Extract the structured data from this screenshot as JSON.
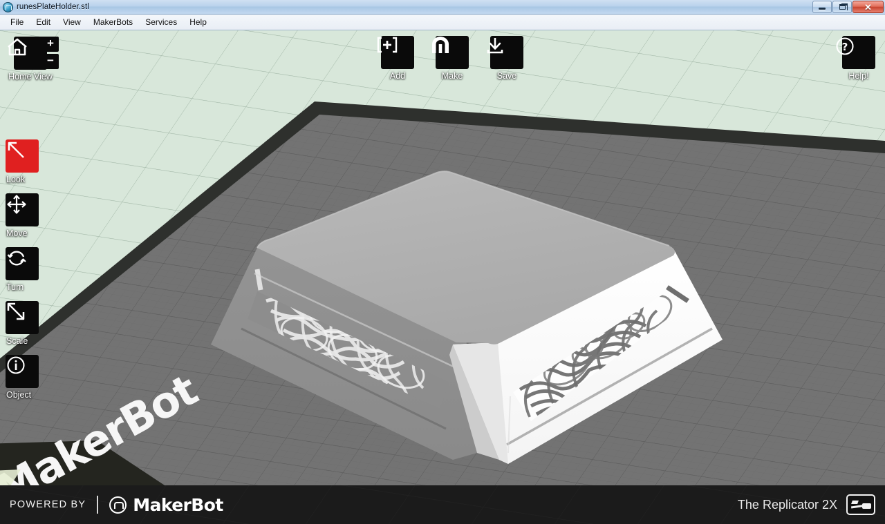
{
  "window": {
    "title": "runesPlateHolder.stl",
    "app_icon": "makerbot-circle-logo-icon",
    "controls": {
      "minimize": "minimize-icon",
      "maximize": "restore-icon",
      "close": "✕"
    }
  },
  "menubar": {
    "items": [
      {
        "label": "File"
      },
      {
        "label": "Edit"
      },
      {
        "label": "View"
      },
      {
        "label": "MakerBots"
      },
      {
        "label": "Services"
      },
      {
        "label": "Help"
      }
    ]
  },
  "viewport": {
    "home_view": {
      "label": "Home View",
      "icon": "home-icon"
    },
    "zoom_in": {
      "label": "+",
      "icon": "plus-icon"
    },
    "zoom_out": {
      "label": "−",
      "icon": "minus-icon"
    },
    "top_tools": [
      {
        "label": "Add",
        "icon": "add-bracket-plus-icon"
      },
      {
        "label": "Make",
        "icon": "makerbot-m-icon"
      },
      {
        "label": "Save",
        "icon": "save-download-arrow-icon"
      }
    ],
    "help": {
      "label": "Help!",
      "icon": "question-circle-icon"
    },
    "left_tools": [
      {
        "label": "Look",
        "icon": "look-arrow-icon",
        "active": true
      },
      {
        "label": "Move",
        "icon": "move-cross-arrows-icon",
        "active": false
      },
      {
        "label": "Turn",
        "icon": "turn-rotate-icon",
        "active": false
      },
      {
        "label": "Scale",
        "icon": "scale-diagonal-arrow-icon",
        "active": false
      },
      {
        "label": "Object",
        "icon": "info-circle-icon",
        "active": false
      }
    ],
    "build_plate_watermark": "MakerBot",
    "colors": {
      "background": "#d8e7da",
      "build_plate": "#7b7b7b",
      "plate_rim": "#2d2f2c",
      "active_tool": "#e02020",
      "tool_box": "#0a0a0a",
      "model_top": "#b2b2b2",
      "model_left_face": "#8f8f8f",
      "model_right_face": "#fbfbfb"
    }
  },
  "statusbar": {
    "powered_by": "POWERED BY",
    "brand": "MakerBot",
    "brand_mark": "makerbot-circle-m-icon",
    "printer": "The Replicator 2X",
    "printer_icon": "printer-connection-icon"
  }
}
